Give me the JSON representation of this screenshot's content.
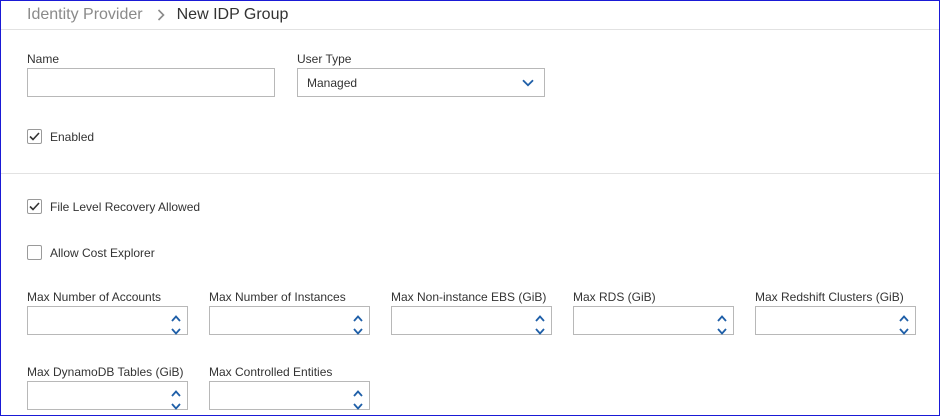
{
  "breadcrumb": {
    "parent": "Identity Provider",
    "current": "New IDP Group"
  },
  "form": {
    "name": {
      "label": "Name",
      "value": ""
    },
    "user_type": {
      "label": "User Type",
      "value": "Managed"
    },
    "enabled": {
      "label": "Enabled",
      "checked": true
    },
    "file_level_recovery": {
      "label": "File Level Recovery Allowed",
      "checked": true
    },
    "allow_cost_explorer": {
      "label": "Allow Cost Explorer",
      "checked": false
    },
    "limits": [
      {
        "label": "Max Number of Accounts",
        "value": ""
      },
      {
        "label": "Max Number of Instances",
        "value": ""
      },
      {
        "label": "Max Non-instance EBS (GiB)",
        "value": ""
      },
      {
        "label": "Max RDS (GiB)",
        "value": ""
      },
      {
        "label": "Max Redshift Clusters (GiB)",
        "value": ""
      },
      {
        "label": "Max DynamoDB Tables (GiB)",
        "value": ""
      },
      {
        "label": "Max Controlled Entities",
        "value": ""
      }
    ]
  },
  "colors": {
    "accent_blue": "#1f5fa8",
    "frame_border": "#1a1ad6",
    "checkmark": "#333333"
  }
}
